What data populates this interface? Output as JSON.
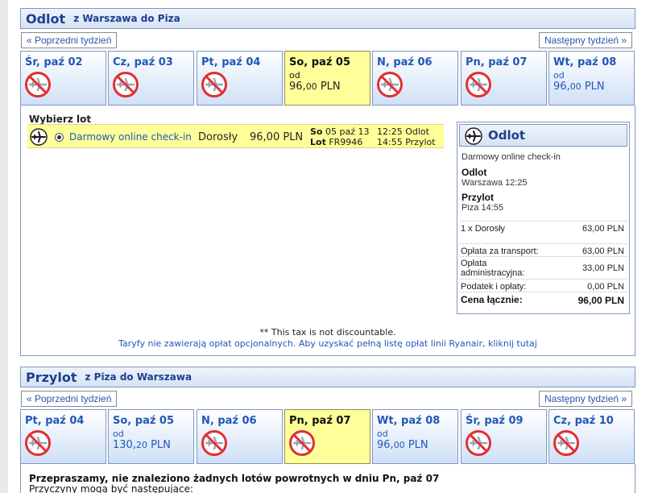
{
  "outbound": {
    "title": "Odlot",
    "route": "z Warszawa do Piza",
    "prev_week": "« Poprzedni tydzień",
    "next_week": "Następny tydzień »",
    "days": [
      {
        "label": "Śr, paź 02",
        "available": false,
        "from": "",
        "price_main": "",
        "price_dec": "",
        "price_cur": ""
      },
      {
        "label": "Cz, paź 03",
        "available": false,
        "from": "",
        "price_main": "",
        "price_dec": "",
        "price_cur": ""
      },
      {
        "label": "Pt, paź 04",
        "available": false,
        "from": "",
        "price_main": "",
        "price_dec": "",
        "price_cur": ""
      },
      {
        "label": "So, paź 05",
        "available": true,
        "selected": true,
        "from": "od",
        "price_main": "96,",
        "price_dec": "00",
        "price_cur": " PLN"
      },
      {
        "label": "N, paź 06",
        "available": false,
        "from": "",
        "price_main": "",
        "price_dec": "",
        "price_cur": ""
      },
      {
        "label": "Pn, paź 07",
        "available": false,
        "from": "",
        "price_main": "",
        "price_dec": "",
        "price_cur": ""
      },
      {
        "label": "Wt, paź 08",
        "available": true,
        "from": "od",
        "price_main": "96,",
        "price_dec": "00",
        "price_cur": " PLN"
      }
    ],
    "choose_title": "Wybierz lot",
    "flight": {
      "checkin": "Darmowy online check-in",
      "passenger": "Dorosły",
      "fare": "96,00 PLN",
      "day_bold": "So",
      "date": "05 paź 13",
      "lot_bold": "Lot",
      "flight_no": "FR9946",
      "dep_time": "12:25",
      "dep_label": "Odlot",
      "arr_time": "14:55",
      "arr_label": "Przylot"
    },
    "summary": {
      "title": "Odlot",
      "checkin": "Darmowy online check-in",
      "dep_label": "Odlot",
      "dep_value": "Warszawa 12:25",
      "arr_label": "Przylot",
      "arr_value": "Piza 14:55",
      "passenger_label": "1 x Dorosły",
      "passenger_price": "63,00 PLN",
      "transport_label": "Opłata za transport:",
      "transport_price": "63,00 PLN",
      "admin_label_1": "Opłata",
      "admin_label_2": "administracyjna:",
      "admin_price": "33,00 PLN",
      "tax_label": "Podatek i opłaty:",
      "tax_price": "0,00 PLN",
      "total_label": "Cena łącznie:",
      "total_price": "96,00 PLN"
    },
    "note_tax": "** This tax is not discountable.",
    "note_link": "Taryfy nie zawierają opłat opcjonalnych. Aby uzyskać pełną listę opłat linii Ryanair, kliknij tutaj"
  },
  "inbound": {
    "title": "Przylot",
    "route": "z Piza do Warszawa",
    "prev_week": "« Poprzedni tydzień",
    "next_week": "Następny tydzień »",
    "days": [
      {
        "label": "Pt, paź 04",
        "available": false,
        "from": "",
        "price_main": "",
        "price_dec": "",
        "price_cur": ""
      },
      {
        "label": "So, paź 05",
        "available": true,
        "from": "od",
        "price_main": "130,",
        "price_dec": "20",
        "price_cur": " PLN"
      },
      {
        "label": "N, paź 06",
        "available": false,
        "from": "",
        "price_main": "",
        "price_dec": "",
        "price_cur": ""
      },
      {
        "label": "Pn, paź 07",
        "available": false,
        "selected": true,
        "from": "",
        "price_main": "",
        "price_dec": "",
        "price_cur": ""
      },
      {
        "label": "Wt, paź 08",
        "available": true,
        "from": "od",
        "price_main": "96,",
        "price_dec": "00",
        "price_cur": " PLN"
      },
      {
        "label": "Śr, paź 09",
        "available": false,
        "from": "",
        "price_main": "",
        "price_dec": "",
        "price_cur": ""
      },
      {
        "label": "Cz, paź 10",
        "available": false,
        "from": "",
        "price_main": "",
        "price_dec": "",
        "price_cur": ""
      }
    ],
    "sorry_title": "Przepraszamy, nie znaleziono żadnych lotów powrotnych w dniu Pn, paź 07",
    "sorry_sub": "Przyczyny mogą być następujące:"
  },
  "colors": {
    "link": "#2157b8",
    "header_text": "#1d3f8f",
    "selected_tab": "#ffff9a",
    "no_flight": "#e03030"
  },
  "icons": {
    "plane": "airplane-icon",
    "no_flight": "no-flight-icon"
  }
}
